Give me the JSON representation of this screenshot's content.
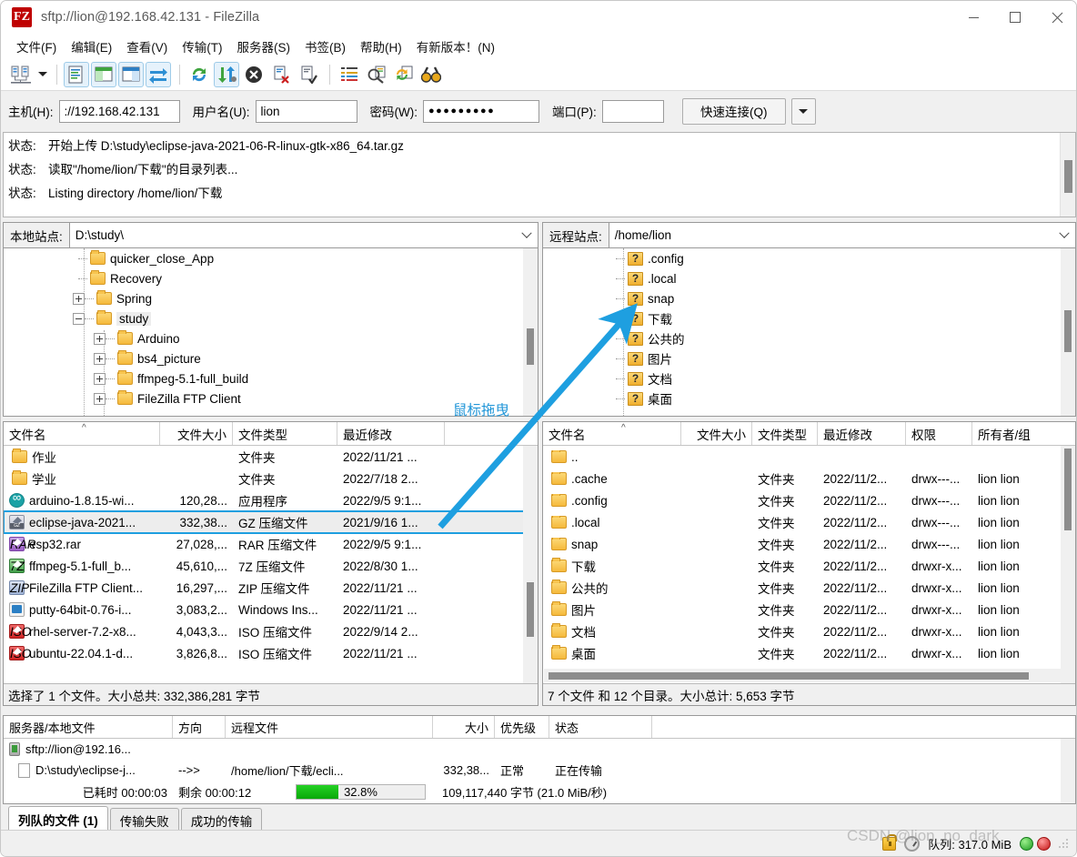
{
  "window": {
    "title": "sftp://lion@192.168.42.131 - FileZilla",
    "logo_text": "FZ",
    "minimize": "—",
    "maximize": "□",
    "close": "✕"
  },
  "menu": [
    {
      "label": "文件(F)",
      "name": "menu-file"
    },
    {
      "label": "编辑(E)",
      "name": "menu-edit"
    },
    {
      "label": "查看(V)",
      "name": "menu-view"
    },
    {
      "label": "传输(T)",
      "name": "menu-transfer"
    },
    {
      "label": "服务器(S)",
      "name": "menu-server"
    },
    {
      "label": "书签(B)",
      "name": "menu-bookmarks"
    },
    {
      "label": "帮助(H)",
      "name": "menu-help"
    },
    {
      "label": "有新版本！(N)",
      "name": "menu-new-version"
    }
  ],
  "toolbar": [
    {
      "name": "site-manager-icon",
      "glyph": "site-manager"
    },
    {
      "name": "site-manager-dropdown-icon",
      "glyph": "caret"
    },
    {
      "name": "separator-1",
      "glyph": "sep"
    },
    {
      "name": "toggle-message-log-icon",
      "glyph": "msglog",
      "active": true
    },
    {
      "name": "toggle-local-tree-icon",
      "glyph": "localtree",
      "active": true
    },
    {
      "name": "toggle-remote-tree-icon",
      "glyph": "remotetree",
      "active": true
    },
    {
      "name": "toggle-transfer-queue-icon",
      "glyph": "queue",
      "active": true
    },
    {
      "name": "separator-2",
      "glyph": "sep"
    },
    {
      "name": "refresh-icon",
      "glyph": "refresh"
    },
    {
      "name": "process-queue-icon",
      "glyph": "processqueue",
      "active": true
    },
    {
      "name": "cancel-operation-icon",
      "glyph": "cancel"
    },
    {
      "name": "disconnect-icon",
      "glyph": "disconnect"
    },
    {
      "name": "reconnect-icon",
      "glyph": "reconnect"
    },
    {
      "name": "separator-3",
      "glyph": "sep"
    },
    {
      "name": "filter-icon",
      "glyph": "filter"
    },
    {
      "name": "compare-directories-icon",
      "glyph": "compare"
    },
    {
      "name": "synchronized-browsing-icon",
      "glyph": "sync"
    },
    {
      "name": "search-remote-files-icon",
      "glyph": "binoculars"
    }
  ],
  "connection": {
    "host_label": "主机(H):",
    "host_value": "://192.168.42.131",
    "user_label": "用户名(U):",
    "user_value": "lion",
    "pass_label": "密码(W):",
    "pass_value": "●●●●●●●●●",
    "port_label": "端口(P):",
    "port_value": "",
    "port_placeholder": "",
    "quick_connect": "快速连接(Q)",
    "quick_connect_dropdown": "▾"
  },
  "log": {
    "rows": [
      {
        "key": "状态:",
        "text": "开始上传 D:\\study\\eclipse-java-2021-06-R-linux-gtk-x86_64.tar.gz"
      },
      {
        "key": "状态:",
        "text": "读取\"/home/lion/下载\"的目录列表..."
      },
      {
        "key": "状态:",
        "text": "Listing directory /home/lion/下载"
      }
    ]
  },
  "local": {
    "site_label": "本地站点:",
    "site_path": "D:\\study\\",
    "tree": [
      {
        "label": "quicker_close_App",
        "indent": 1,
        "toggle": "none",
        "icon": "folder-icon"
      },
      {
        "label": "Recovery",
        "indent": 1,
        "toggle": "none",
        "icon": "folder-icon"
      },
      {
        "label": "Spring",
        "indent": 1,
        "toggle": "plus",
        "icon": "folder-icon"
      },
      {
        "label": "study",
        "indent": 1,
        "toggle": "minus",
        "icon": "folder-icon",
        "selected": true
      },
      {
        "label": "Arduino",
        "indent": 2,
        "toggle": "plus",
        "icon": "folder-icon"
      },
      {
        "label": "bs4_picture",
        "indent": 2,
        "toggle": "plus",
        "icon": "folder-icon"
      },
      {
        "label": "ffmpeg-5.1-full_build",
        "indent": 2,
        "toggle": "plus",
        "icon": "folder-icon"
      },
      {
        "label": "FileZilla FTP Client",
        "indent": 2,
        "toggle": "plus",
        "icon": "folder-icon"
      }
    ],
    "columns": [
      "文件名",
      "文件大小",
      "文件类型",
      "最近修改"
    ],
    "files": [
      {
        "name": "作业",
        "size": "",
        "type": "文件夹",
        "modified": "2022/11/21 ...",
        "icon": "folder-icon"
      },
      {
        "name": "学业",
        "size": "",
        "type": "文件夹",
        "modified": "2022/7/18 2...",
        "icon": "folder-icon"
      },
      {
        "name": "arduino-1.8.15-wi...",
        "size": "120,28...",
        "type": "应用程序",
        "modified": "2022/9/5 9:1...",
        "icon": "arduino-icon"
      },
      {
        "name": "eclipse-java-2021...",
        "size": "332,38...",
        "type": "GZ 压缩文件",
        "modified": "2021/9/16 1...",
        "icon": "gz-archive-icon",
        "selected": true
      },
      {
        "name": "esp32.rar",
        "size": "27,028,...",
        "type": "RAR 压缩文件",
        "modified": "2022/9/5 9:1...",
        "icon": "rar-archive-icon"
      },
      {
        "name": "ffmpeg-5.1-full_b...",
        "size": "45,610,...",
        "type": "7Z 压缩文件",
        "modified": "2022/8/30 1...",
        "icon": "7z-archive-icon"
      },
      {
        "name": "FileZilla FTP Client...",
        "size": "16,297,...",
        "type": "ZIP 压缩文件",
        "modified": "2022/11/21 ...",
        "icon": "zip-archive-icon"
      },
      {
        "name": "putty-64bit-0.76-i...",
        "size": "3,083,2...",
        "type": "Windows Ins...",
        "modified": "2022/11/21 ...",
        "icon": "msi-installer-icon"
      },
      {
        "name": "rhel-server-7.2-x8...",
        "size": "4,043,3...",
        "type": "ISO 压缩文件",
        "modified": "2022/9/14 2...",
        "icon": "iso-archive-icon"
      },
      {
        "name": "ubuntu-22.04.1-d...",
        "size": "3,826,8...",
        "type": "ISO 压缩文件",
        "modified": "2022/11/21 ...",
        "icon": "iso-archive-icon"
      }
    ],
    "status": "选择了 1 个文件。大小总共: 332,386,281 字节"
  },
  "remote": {
    "site_label": "远程站点:",
    "site_path": "/home/lion",
    "tree": [
      {
        "label": ".config",
        "icon": "unknown-folder-icon"
      },
      {
        "label": ".local",
        "icon": "unknown-folder-icon"
      },
      {
        "label": "snap",
        "icon": "unknown-folder-icon"
      },
      {
        "label": "下载",
        "icon": "unknown-folder-icon"
      },
      {
        "label": "公共的",
        "icon": "unknown-folder-icon"
      },
      {
        "label": "图片",
        "icon": "unknown-folder-icon"
      },
      {
        "label": "文档",
        "icon": "unknown-folder-icon"
      },
      {
        "label": "桌面",
        "icon": "unknown-folder-icon"
      }
    ],
    "columns": [
      "文件名",
      "文件大小",
      "文件类型",
      "最近修改",
      "权限",
      "所有者/组"
    ],
    "files": [
      {
        "name": "..",
        "size": "",
        "type": "",
        "modified": "",
        "perms": "",
        "owner": "",
        "icon": "folder-icon"
      },
      {
        "name": ".cache",
        "size": "",
        "type": "文件夹",
        "modified": "2022/11/2...",
        "perms": "drwx---...",
        "owner": "lion lion",
        "icon": "folder-icon"
      },
      {
        "name": ".config",
        "size": "",
        "type": "文件夹",
        "modified": "2022/11/2...",
        "perms": "drwx---...",
        "owner": "lion lion",
        "icon": "folder-icon"
      },
      {
        "name": ".local",
        "size": "",
        "type": "文件夹",
        "modified": "2022/11/2...",
        "perms": "drwx---...",
        "owner": "lion lion",
        "icon": "folder-icon"
      },
      {
        "name": "snap",
        "size": "",
        "type": "文件夹",
        "modified": "2022/11/2...",
        "perms": "drwx---...",
        "owner": "lion lion",
        "icon": "folder-icon"
      },
      {
        "name": "下载",
        "size": "",
        "type": "文件夹",
        "modified": "2022/11/2...",
        "perms": "drwxr-x...",
        "owner": "lion lion",
        "icon": "folder-icon"
      },
      {
        "name": "公共的",
        "size": "",
        "type": "文件夹",
        "modified": "2022/11/2...",
        "perms": "drwxr-x...",
        "owner": "lion lion",
        "icon": "folder-icon"
      },
      {
        "name": "图片",
        "size": "",
        "type": "文件夹",
        "modified": "2022/11/2...",
        "perms": "drwxr-x...",
        "owner": "lion lion",
        "icon": "folder-icon"
      },
      {
        "name": "文档",
        "size": "",
        "type": "文件夹",
        "modified": "2022/11/2...",
        "perms": "drwxr-x...",
        "owner": "lion lion",
        "icon": "folder-icon"
      },
      {
        "name": "桌面",
        "size": "",
        "type": "文件夹",
        "modified": "2022/11/2...",
        "perms": "drwxr-x...",
        "owner": "lion lion",
        "icon": "folder-icon"
      }
    ],
    "status": "7 个文件 和 12 个目录。大小总计: 5,653 字节"
  },
  "queue": {
    "columns": [
      "服务器/本地文件",
      "方向",
      "远程文件",
      "大小",
      "优先级",
      "状态"
    ],
    "server_row": "sftp://lion@192.16...",
    "transfer": {
      "local_file": "D:\\study\\eclipse-j...",
      "direction": "-->>",
      "remote_file": "/home/lion/下载/ecli...",
      "size": "332,38...",
      "priority": "正常",
      "status": "正在传输"
    },
    "progress": {
      "elapsed_label": "已耗时 00:00:03",
      "remaining_label": "剩余 00:00:12",
      "percent_text": "32.8%",
      "percent_value": 32.8,
      "bytes_text": "109,117,440 字节 (21.0 MiB/秒)"
    }
  },
  "tabs": [
    {
      "label": "列队的文件 (1)",
      "selected": true,
      "name": "tab-queued-files"
    },
    {
      "label": "传输失败",
      "selected": false,
      "name": "tab-failed-transfers"
    },
    {
      "label": "成功的传输",
      "selected": false,
      "name": "tab-successful-transfers"
    }
  ],
  "statusbar": {
    "queue_size": "队列: 317.0 MiB",
    "lock_icon": "lock-icon",
    "speed_icon": "speed-gauge-icon",
    "up_indicator": "green-indicator",
    "down_indicator": "red-indicator"
  },
  "annotation": {
    "label": "鼠标拖曳",
    "color": "#1e9fe0"
  },
  "watermark": "CSDN @lion_no_dark",
  "colors": {
    "accent": "#1e9fe0",
    "progress_green": "#0aa80a",
    "folder_yellow": "#f5b93c",
    "titlebar_text": "#5a5a5a"
  }
}
